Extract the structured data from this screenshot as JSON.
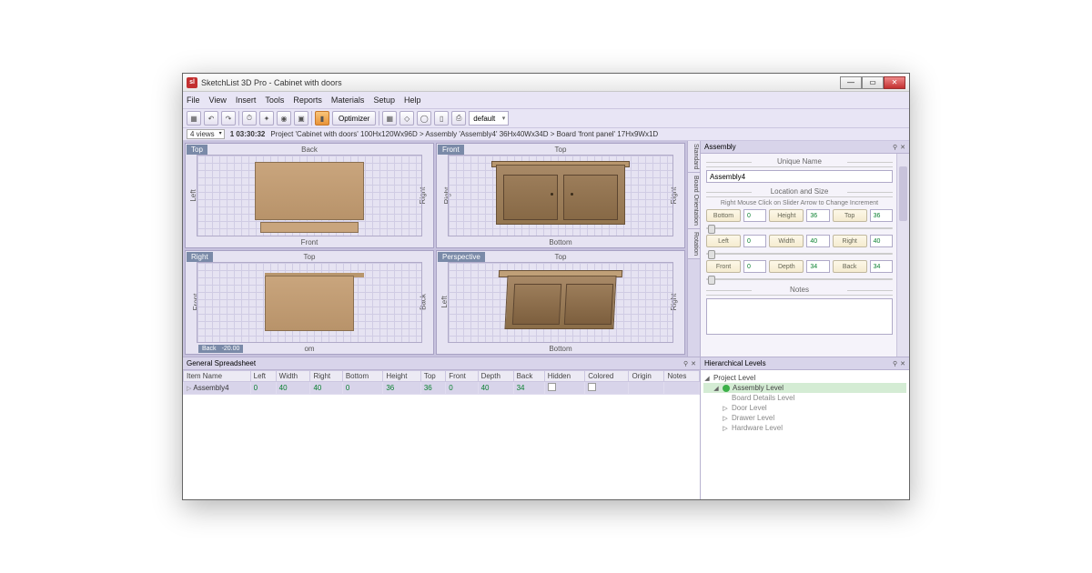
{
  "title": "SketchList 3D Pro - Cabinet with doors",
  "menus": [
    "File",
    "View",
    "Insert",
    "Tools",
    "Reports",
    "Materials",
    "Setup",
    "Help"
  ],
  "toolbar": {
    "optimizer": "Optimizer",
    "dropdown": "default"
  },
  "crumb": {
    "views": "4 views",
    "time": "1 03:30:32",
    "path": "Project 'Cabinet with doors' 100Hx120Wx96D > Assembly 'Assembly4' 36Hx40Wx34D > Board 'front panel' 17Hx9Wx1D"
  },
  "viewports": {
    "v1": {
      "name": "Top",
      "top": "Back",
      "bottom": "Front",
      "left": "Left",
      "right": "Right"
    },
    "v2": {
      "name": "Front",
      "top": "Top",
      "bottom": "Bottom",
      "left": "Right",
      "right": "Right"
    },
    "v3": {
      "name": "Right",
      "top": "Top",
      "bottom": "om",
      "left": "Front",
      "right": "Back",
      "status_l": "Back",
      "status_v": "-20.00"
    },
    "v4": {
      "name": "Perspective",
      "top": "Top",
      "bottom": "Bottom",
      "left": "Left",
      "right": "Right"
    }
  },
  "sidetabs": [
    "Standard",
    "Board Orientation",
    "Rotation"
  ],
  "assembly": {
    "header": "Assembly",
    "unique_name_label": "Unique Name",
    "unique_name": "Assembly4",
    "locsize": "Location and Size",
    "hint": "Right Mouse Click on Slider Arrow to Change Increment",
    "rows": [
      {
        "a": "Bottom",
        "av": "0",
        "b": "Height",
        "bv": "36",
        "c": "Top",
        "cv": "36"
      },
      {
        "a": "Left",
        "av": "0",
        "b": "Width",
        "bv": "40",
        "c": "Right",
        "cv": "40"
      },
      {
        "a": "Front",
        "av": "0",
        "b": "Depth",
        "bv": "34",
        "c": "Back",
        "cv": "34"
      }
    ],
    "notes": "Notes"
  },
  "spreadsheet": {
    "header": "General Spreadsheet",
    "cols": [
      "Item Name",
      "Left",
      "Width",
      "Right",
      "Bottom",
      "Height",
      "Top",
      "Front",
      "Depth",
      "Back",
      "Hidden",
      "Colored",
      "Origin",
      "Notes"
    ],
    "row": {
      "name": "Assembly4",
      "vals": [
        "0",
        "40",
        "40",
        "0",
        "36",
        "36",
        "0",
        "40",
        "34"
      ]
    }
  },
  "hier": {
    "header": "Hierarchical Levels",
    "nodes": [
      "Project Level",
      "Assembly Level",
      "Board Details Level",
      "Door Level",
      "Drawer Level",
      "Hardware Level"
    ]
  }
}
